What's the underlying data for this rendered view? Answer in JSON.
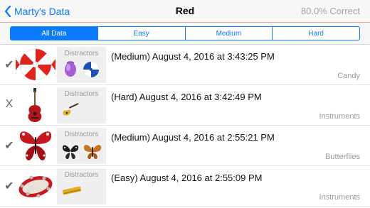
{
  "nav": {
    "back_label": "Marty's Data",
    "title": "Red",
    "score": "80.0% Correct"
  },
  "segments": [
    {
      "label": "All Data",
      "active": true
    },
    {
      "label": "Easy",
      "active": false
    },
    {
      "label": "Medium",
      "active": false
    },
    {
      "label": "Hard",
      "active": false
    }
  ],
  "rows": [
    {
      "result": "✔",
      "distractors_label": "Distractors",
      "date": "(Medium) August 4, 2016 at 3:43:25 PM",
      "category": "Candy"
    },
    {
      "result": "X",
      "distractors_label": "Distractors",
      "date": "(Hard) August 4, 2016 at 3:42:49 PM",
      "category": "Instruments"
    },
    {
      "result": "✔",
      "distractors_label": "Distractors",
      "date": "(Medium) August 4, 2016 at 2:55:21 PM",
      "category": "Butterflies"
    },
    {
      "result": "✔",
      "distractors_label": "Distractors",
      "date": "(Easy) August 4, 2016 at 2:55:09 PM",
      "category": "Instruments"
    }
  ],
  "colors": {
    "accent": "#0a7aff",
    "target_red": "#d9251c"
  }
}
